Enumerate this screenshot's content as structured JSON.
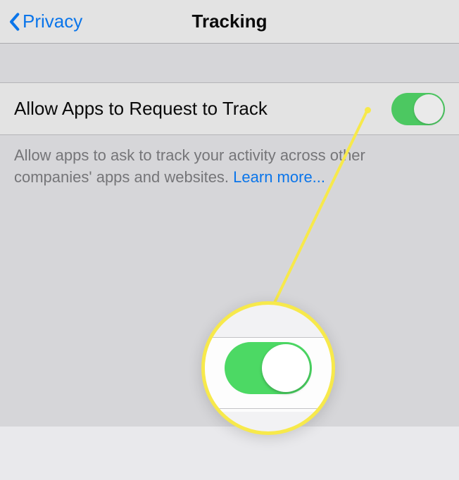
{
  "nav": {
    "back_label": "Privacy",
    "title": "Tracking"
  },
  "setting": {
    "label": "Allow Apps to Request to Track",
    "toggle_on": true
  },
  "description": {
    "text": "Allow apps to ask to track your activity across other companies' apps and websites. ",
    "learn_more": "Learn more..."
  },
  "colors": {
    "accent_blue": "#007aff",
    "toggle_green": "#4cd964",
    "callout_yellow": "#f7e94b"
  }
}
